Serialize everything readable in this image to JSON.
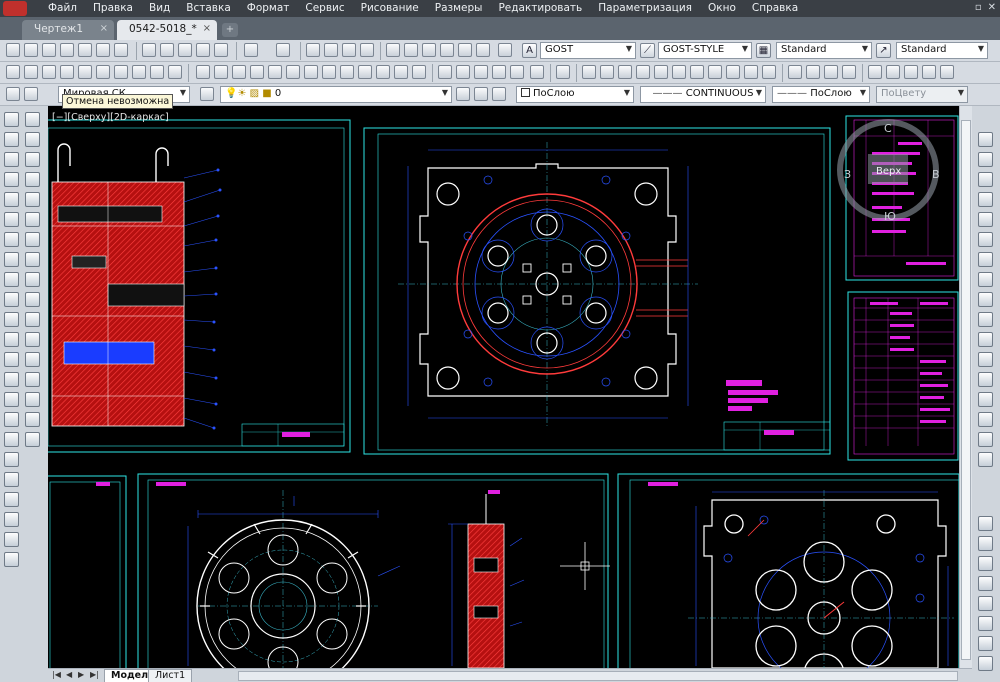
{
  "menu": {
    "items": [
      "Файл",
      "Правка",
      "Вид",
      "Вставка",
      "Формат",
      "Сервис",
      "Рисование",
      "Размеры",
      "Редактировать",
      "Параметризация",
      "Окно",
      "Справка"
    ]
  },
  "tabs": [
    {
      "label": "Чертеж1",
      "close": "×"
    },
    {
      "label": "0542-5018_*",
      "close": "×"
    }
  ],
  "toolbar": {
    "text_style": "GOST",
    "dim_style": "GOST-STYLE",
    "table_style": "Standard",
    "mleader_style": "Standard",
    "ucs": "Мировая СК",
    "layer_current": "0",
    "color": "ПоСлою",
    "linetype": "CONTINUOUS",
    "lineweight": "ПоСлою",
    "plotstyle": "ПоЦвету"
  },
  "tooltip": "Отмена невозможна",
  "viewport": {
    "label": "[−][Сверху][2D-каркас]"
  },
  "viewcube": {
    "top": "С",
    "west": "З",
    "east": "В",
    "face": "Верх",
    "bottom": "Ю"
  },
  "layouts": [
    "Модель",
    "Лист1"
  ],
  "colors": {
    "frame": "#2ee6e6",
    "section_hatch": "#cc1515",
    "outline": "#ffffff",
    "dim": "#2a52ff",
    "center": "#3ab7c9",
    "title_magenta": "#e020e0",
    "hatch_red": "#ff3b3b"
  }
}
